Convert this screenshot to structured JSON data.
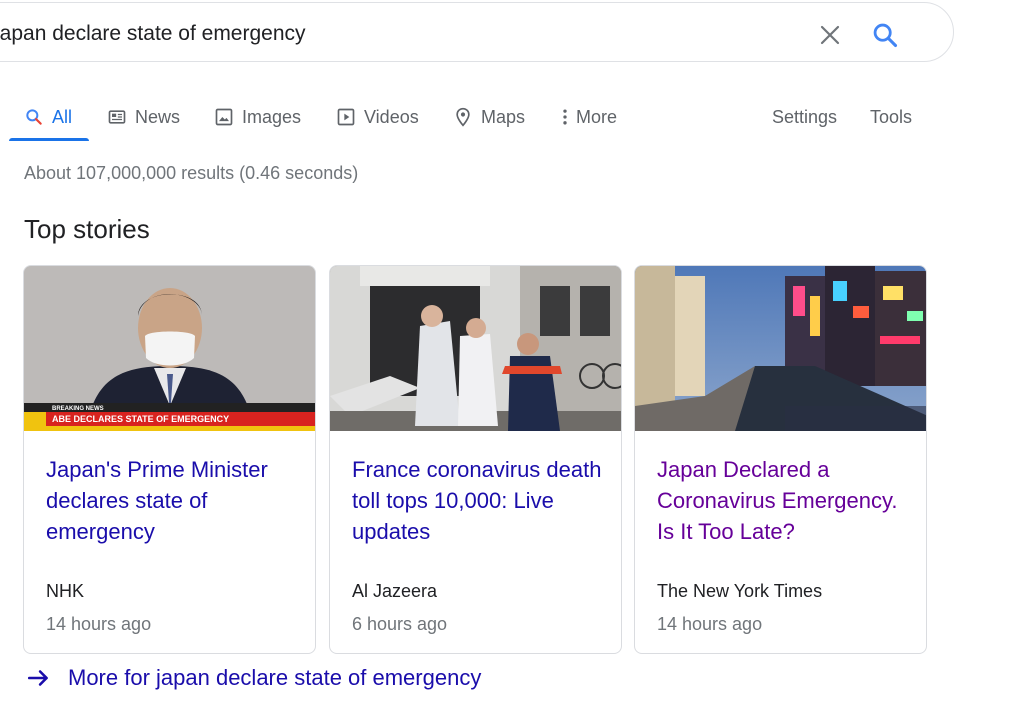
{
  "search": {
    "query": "japan declare state of emergency"
  },
  "tabs": [
    {
      "label": "All",
      "icon": "search-icon",
      "active": true
    },
    {
      "label": "News",
      "icon": "newspaper-icon"
    },
    {
      "label": "Images",
      "icon": "image-icon"
    },
    {
      "label": "Videos",
      "icon": "play-icon"
    },
    {
      "label": "Maps",
      "icon": "map-pin-icon"
    },
    {
      "label": "More",
      "icon": "more-vert-icon"
    }
  ],
  "tools": {
    "settings": "Settings",
    "tools": "Tools"
  },
  "result_stats": "About 107,000,000 results (0.46 seconds)",
  "top_stories": {
    "heading": "Top stories",
    "cards": [
      {
        "title": "Japan's Prime Minister declares state of emergency",
        "source": "NHK",
        "time": "14 hours ago",
        "banner_small": "BREAKING NEWS",
        "banner": "ABE DECLARES STATE OF EMERGENCY"
      },
      {
        "title": "France coronavirus death toll tops 10,000: Live updates",
        "source": "Al Jazeera",
        "time": "6 hours ago"
      },
      {
        "title": "Japan Declared a Coronavirus Emergency. Is It Too Late?",
        "source": "The New York Times",
        "time": "14 hours ago"
      }
    ],
    "more_link": "More for japan declare state of emergency"
  },
  "colors": {
    "link": "#1a0dab",
    "visited": "#660099",
    "accent": "#1a73e8",
    "secondary_text": "#70757a"
  }
}
